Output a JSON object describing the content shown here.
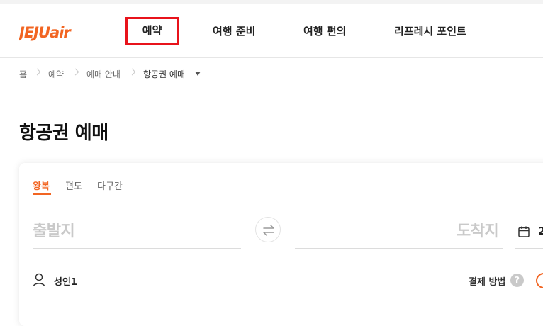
{
  "header": {
    "logo_text": "JEJUair",
    "brand_color": "#f26522",
    "nav": [
      {
        "label": "예약",
        "active": true
      },
      {
        "label": "여행 준비"
      },
      {
        "label": "여행 편의"
      },
      {
        "label": "리프레시 포인트"
      }
    ]
  },
  "breadcrumb": {
    "items": [
      "홈",
      "예약",
      "예매 안내",
      "항공권 예매"
    ]
  },
  "page": {
    "title": "항공권 예매"
  },
  "booking": {
    "tabs": [
      {
        "label": "왕복",
        "active": true
      },
      {
        "label": "편도"
      },
      {
        "label": "다구간"
      }
    ],
    "departure_placeholder": "출발지",
    "arrival_placeholder": "도착지",
    "date_partial": "2",
    "passengers": "성인1",
    "payment_method_label": "결제 방법",
    "help_glyph": "?"
  },
  "icons": [
    "swap-arrows-icon",
    "calendar-icon",
    "person-icon",
    "help-icon"
  ]
}
